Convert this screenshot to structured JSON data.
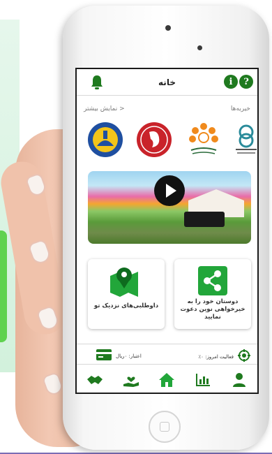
{
  "header": {
    "title": "خانه"
  },
  "info_icon_glyph": "i",
  "help_icon_glyph": "?",
  "charities_section": {
    "show_more": "نمایش بیشتر >",
    "title": "خیریه‌ها"
  },
  "cards": [
    {
      "label": "داوطلبی‌های نزدیک تو",
      "icon": "map-pin-icon"
    },
    {
      "label": "دوستان خود را به خیرخواهی نوین دعوت نمایید",
      "icon": "share-icon"
    }
  ],
  "status": {
    "credit": "اعتبار: ۰ریال",
    "activity": "فعالیت امروز: ۰٪"
  },
  "bottom_nav": [
    {
      "icon": "handshake-icon"
    },
    {
      "icon": "hand-heart-icon"
    },
    {
      "icon": "home-icon"
    },
    {
      "icon": "chart-icon"
    },
    {
      "icon": "user-icon"
    }
  ],
  "colors": {
    "accent": "#1f7a1f",
    "bright_green": "#22a63a"
  }
}
